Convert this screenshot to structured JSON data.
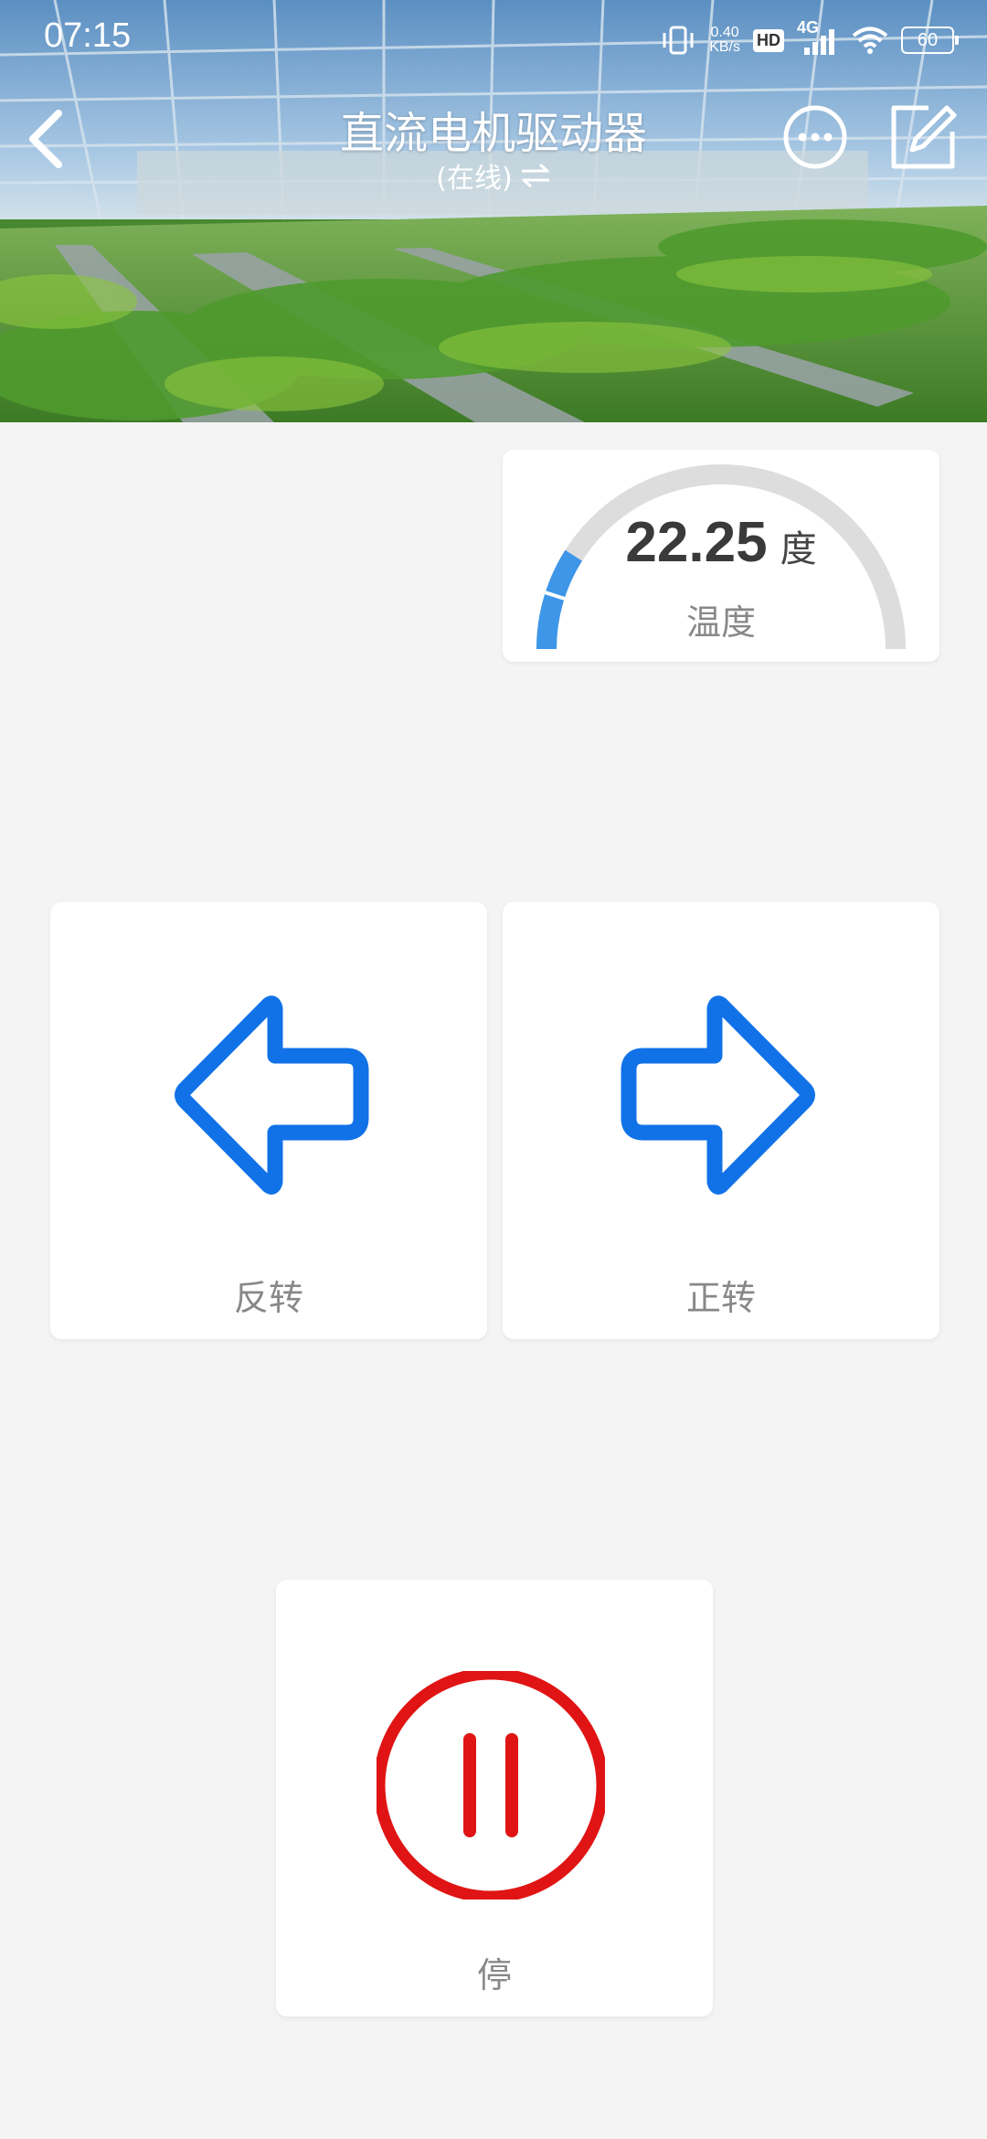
{
  "status_bar": {
    "time": "07:15",
    "net_speed": "0.40",
    "net_unit": "KB/s",
    "hd": "HD",
    "network": "4G",
    "battery": "60",
    "icons": [
      "vibrate-icon",
      "hd-icon",
      "signal-icon",
      "wifi-icon",
      "battery-icon"
    ]
  },
  "header": {
    "title": "直流电机驱动器",
    "subtitle": "(在线)",
    "subtitle_icon": "swap-arrows-icon",
    "back_icon": "chevron-left-icon",
    "more_icon": "more-circle-icon",
    "edit_icon": "edit-icon"
  },
  "gauge": {
    "value": "22.25",
    "unit": "度",
    "label": "温度",
    "fill_fraction": 0.18,
    "track_color": "#dddddd",
    "fill_color": "#3d96e8"
  },
  "controls": {
    "reverse_label": "反转",
    "forward_label": "正转",
    "stop_label": "停",
    "arrow_color": "#1172e8",
    "stop_color": "#e01414"
  }
}
